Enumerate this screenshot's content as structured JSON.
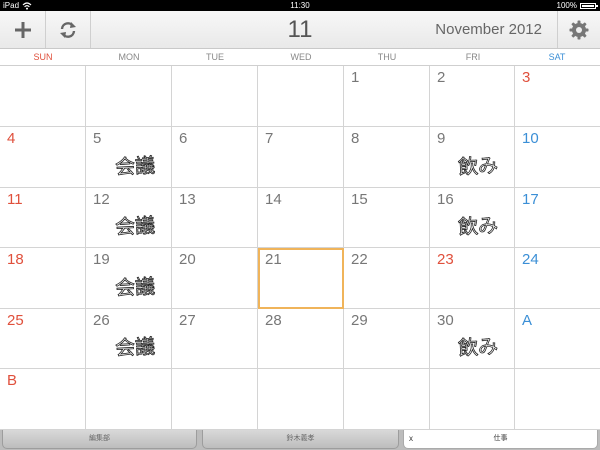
{
  "status_bar": {
    "device": "iPad",
    "time": "11:30",
    "battery": "100%",
    "battery_level": 1.0
  },
  "toolbar": {
    "add_icon": "plus-icon",
    "sync_icon": "refresh-icon",
    "settings_icon": "gear-icon",
    "selected_day": "11",
    "month_label": "November 2012"
  },
  "weekdays": [
    "SUN",
    "MON",
    "TUE",
    "WED",
    "THU",
    "FRI",
    "SAT"
  ],
  "calendar": {
    "weeks": [
      [
        "",
        "",
        "",
        "",
        "1",
        "2",
        "3"
      ],
      [
        "4",
        "5",
        "6",
        "7",
        "8",
        "9",
        "10"
      ],
      [
        "11",
        "12",
        "13",
        "14",
        "15",
        "16",
        "17"
      ],
      [
        "18",
        "19",
        "20",
        "21",
        "22",
        "23",
        "24"
      ],
      [
        "25",
        "26",
        "27",
        "28",
        "29",
        "30",
        "A"
      ],
      [
        "B",
        "",
        "",
        "",
        "",
        "",
        ""
      ]
    ],
    "today": "21",
    "holidays": [
      "3",
      "23"
    ],
    "notes": [
      {
        "day": "5",
        "text": "会議"
      },
      {
        "day": "9",
        "text": "飲み"
      },
      {
        "day": "12",
        "text": "会議"
      },
      {
        "day": "16",
        "text": "飲み"
      },
      {
        "day": "19",
        "text": "会議"
      },
      {
        "day": "26",
        "text": "会議"
      },
      {
        "day": "30",
        "text": "飲み"
      }
    ]
  },
  "tabs": [
    {
      "label": "編集部",
      "active": false
    },
    {
      "label": "鈴木義孝",
      "active": false
    },
    {
      "label": "仕事",
      "active": true,
      "close_label": "x"
    }
  ],
  "colors": {
    "sunday": "#e0503c",
    "saturday": "#3b8fd6",
    "today_outline": "#f0b45a"
  }
}
